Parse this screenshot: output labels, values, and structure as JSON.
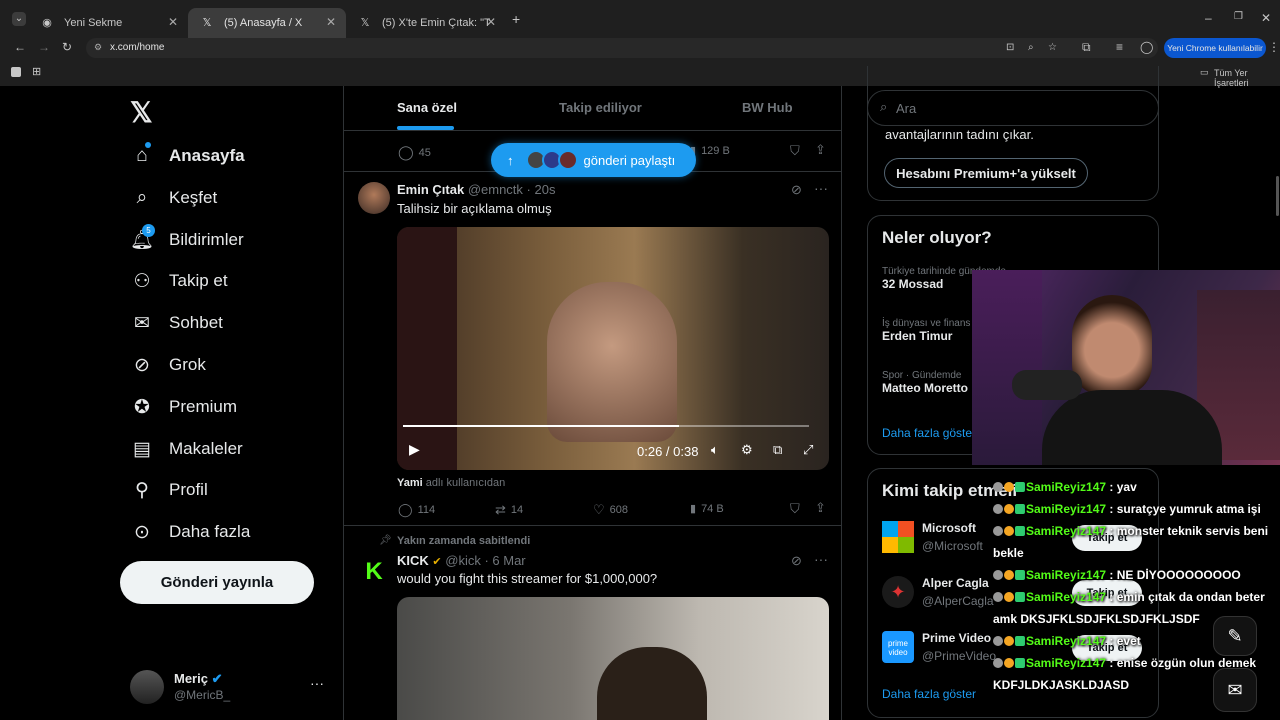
{
  "browser": {
    "tabs": [
      {
        "title": "Yeni Sekme",
        "icon": "chrome-icon"
      },
      {
        "title": "(5) Anasayfa / X",
        "icon": "x-logo-icon"
      },
      {
        "title": "(5) X'te Emin Çıtak: \"Talihsiz bir",
        "icon": "x-logo-icon"
      }
    ],
    "url": "x.com/home",
    "chrome_promo": "Yeni Chrome kullanılabilir",
    "bookmarks_label": "Tüm Yer İşaretleri"
  },
  "sidebar": {
    "items": [
      {
        "label": "Anasayfa",
        "icon": "home-icon"
      },
      {
        "label": "Keşfet",
        "icon": "search-icon"
      },
      {
        "label": "Bildirimler",
        "icon": "bell-icon",
        "badge": "5"
      },
      {
        "label": "Takip et",
        "icon": "person-add-icon"
      },
      {
        "label": "Sohbet",
        "icon": "mail-icon"
      },
      {
        "label": "Grok",
        "icon": "grok-icon"
      },
      {
        "label": "Premium",
        "icon": "verified-icon"
      },
      {
        "label": "Makaleler",
        "icon": "article-icon"
      },
      {
        "label": "Profil",
        "icon": "person-icon"
      },
      {
        "label": "Daha fazla",
        "icon": "more-circle-icon"
      }
    ],
    "post_button": "Gönderi yayınla",
    "user": {
      "name": "Meriç",
      "handle": "@MericB_"
    }
  },
  "feed": {
    "tabs": [
      "Sana özel",
      "Takip ediliyor",
      "BW Hub"
    ],
    "share_pill": "gönderi paylaştı",
    "top_actions": {
      "replies": "45",
      "views": "129 B"
    },
    "tweet1": {
      "name": "Emin Çıtak",
      "handle": "@emnctk",
      "time": "· 20s",
      "text": "Talihsiz bir açıklama olmuş",
      "video_time": "0:26 / 0:38",
      "source_user": "Yami",
      "source_suffix": " adlı kullanıcıdan",
      "replies": "114",
      "reposts": "14",
      "likes": "608",
      "views": "74 B"
    },
    "tweet2": {
      "pinned": "Yakın zamanda sabitlendi",
      "name": "KICK",
      "handle": "@kick",
      "time": "· 6 Mar",
      "text": "would you fight this streamer for $1,000,000?"
    }
  },
  "right": {
    "search_placeholder": "Ara",
    "premium_text": "avantajlarının tadını çıkar.",
    "premium_button": "Hesabını Premium+'a yükselt",
    "trends_title": "Neler oluyor?",
    "trends": [
      {
        "cat": "Türkiye tarihinde gündemde",
        "name": "32 Mossad"
      },
      {
        "cat": "İş dünyası ve finans",
        "name": "Erden Timur"
      },
      {
        "cat": "Spor · Gündemde",
        "name": "Matteo Moretto"
      }
    ],
    "trends_more": "Daha fazla göster",
    "follow_title": "Kimi takip etmeli",
    "follow": [
      {
        "name": "Microsoft",
        "handle": "@Microsoft",
        "button": "Takip et"
      },
      {
        "name": "Alper Cagla",
        "handle": "@AlperCagla",
        "button": "Takip et"
      },
      {
        "name": "Prime Video",
        "handle": "@PrimeVideo",
        "button": "Takip et"
      }
    ],
    "follow_more": "Daha fazla göster"
  },
  "stream_chat": [
    {
      "user": "SamiReyiz147",
      "msg": "yav"
    },
    {
      "user": "SamiReyiz147",
      "msg": "suratçye yumruk atma işi"
    },
    {
      "user": "SamiReyiz147",
      "msg": "monster teknik servis beni bekle"
    },
    {
      "user": "SamiReyiz147",
      "msg": "NE DİYOOOOOOOOO"
    },
    {
      "user": "SamiReyiz147",
      "msg": "emin çıtak da ondan beter amk DKSJFKLSDJFKLSDJFKLJSDF"
    },
    {
      "user": "SamiReyiz147",
      "msg": "evet"
    },
    {
      "user": "SamiReyiz147",
      "msg": "enise özgün olun demek KDFJLDKJASKLDJASD"
    }
  ],
  "colors": {
    "accent": "#1d9bf0",
    "kick_green": "#53fc18",
    "bg": "#000000"
  }
}
